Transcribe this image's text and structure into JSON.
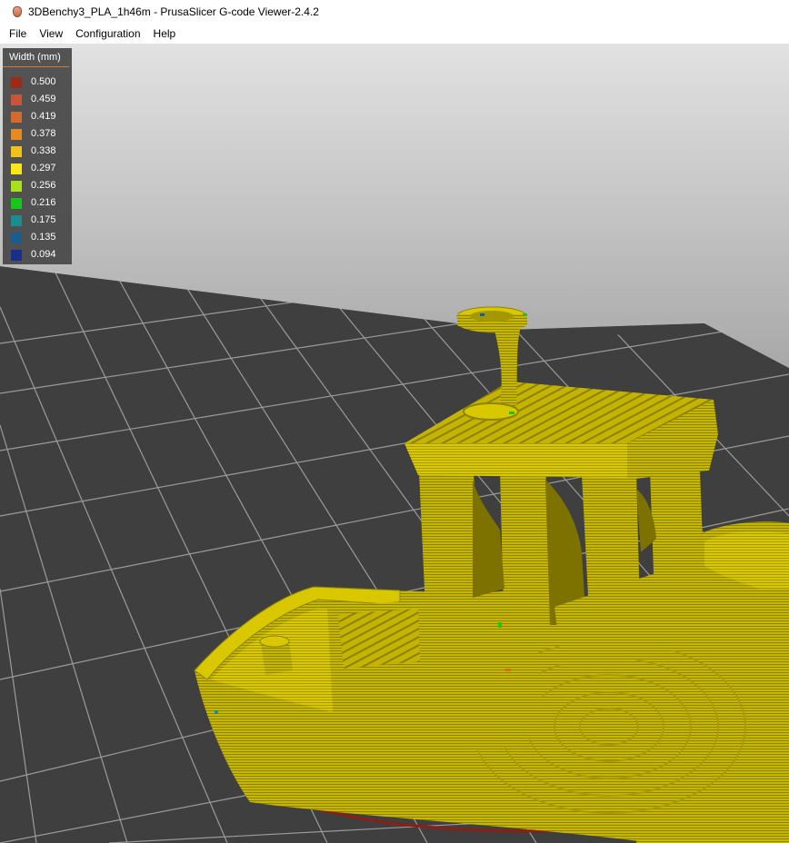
{
  "window": {
    "title": "3DBenchy3_PLA_1h46m - PrusaSlicer G-code Viewer-2.4.2"
  },
  "menu": [
    "File",
    "View",
    "Configuration",
    "Help"
  ],
  "legend": {
    "title": "Width (mm)",
    "items": [
      {
        "label": "0.500",
        "color": "#9b2a1a"
      },
      {
        "label": "0.459",
        "color": "#c9553a"
      },
      {
        "label": "0.419",
        "color": "#d36a2e"
      },
      {
        "label": "0.378",
        "color": "#e68a23"
      },
      {
        "label": "0.338",
        "color": "#f0c21a"
      },
      {
        "label": "0.297",
        "color": "#f7e61a"
      },
      {
        "label": "0.256",
        "color": "#a8e21a"
      },
      {
        "label": "0.216",
        "color": "#19c71a"
      },
      {
        "label": "0.175",
        "color": "#1a8e8e"
      },
      {
        "label": "0.135",
        "color": "#1a5d8c"
      },
      {
        "label": "0.094",
        "color": "#1a2f8c"
      }
    ]
  },
  "colors": {
    "bed": "#3f3f3f",
    "grid": "#9a9a9a",
    "model": "#c8b800",
    "model_dark": "#8f8400",
    "skirt": "#8a1f16"
  }
}
